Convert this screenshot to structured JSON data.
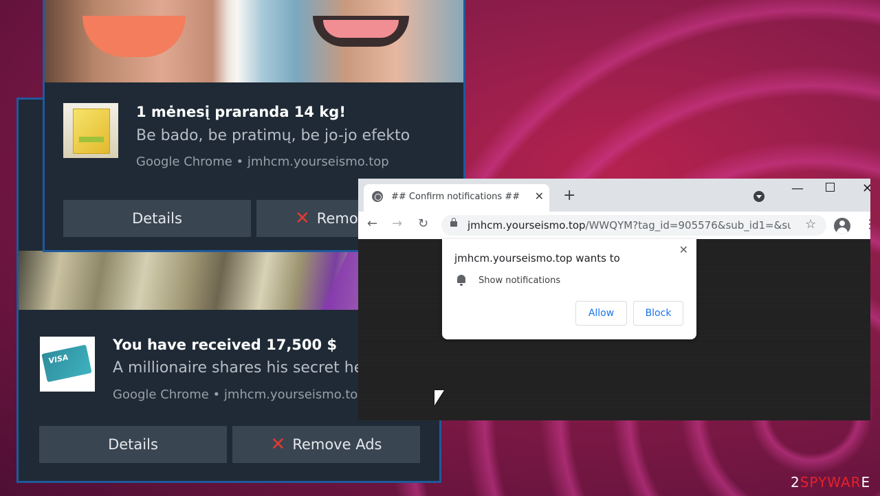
{
  "notifications": [
    {
      "title": "1 mėnesį praranda 14 kg!",
      "body": "Be bado, be pratimų, be jo-jo efekto",
      "source": "Google Chrome • jmhcm.yourseismo.top",
      "details_label": "Details",
      "remove_label": "Remove Ads"
    },
    {
      "title": "You have received 17,500 $",
      "body": "A millionaire shares his secret he",
      "source": "Google Chrome • jmhcm.yourseismo.top",
      "details_label": "Details",
      "remove_label": "Remove Ads",
      "card_text": "VISA"
    }
  ],
  "browser": {
    "tab_title": "## Confirm notifications ##",
    "tab_close": "✕",
    "new_tab": "+",
    "window_controls": {
      "minimize": "—",
      "close": "✕"
    },
    "nav": {
      "back": "←",
      "forward": "→",
      "reload": "↻"
    },
    "url_host": "jmhcm.yourseismo.top",
    "url_path": "/WWQYM?tag_id=905576&sub_id1=&su...",
    "star": "☆",
    "menu": "⋮"
  },
  "permission_prompt": {
    "title": "jmhcm.yourseismo.top wants to",
    "permission": "Show notifications",
    "close": "✕",
    "allow_label": "Allow",
    "block_label": "Block"
  },
  "watermark": {
    "prefix": "2",
    "accent": "SPYWAR",
    "suffix": "E"
  }
}
